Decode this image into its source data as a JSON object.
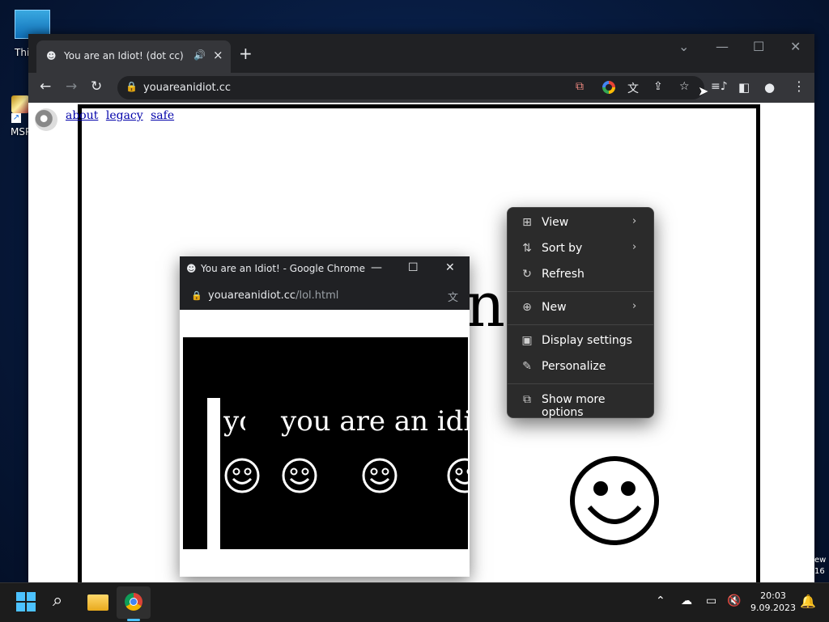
{
  "desktop": {
    "this_pc_label": "Thi",
    "msp_label": "MSP",
    "edge_text": [
      "ew",
      "16"
    ]
  },
  "browser": {
    "tab": {
      "title": "You are an Idiot! (dot cc)"
    },
    "address": {
      "url": "youareanidiot.cc"
    }
  },
  "page": {
    "links": [
      "about",
      "legacy",
      "safe"
    ],
    "big_text": "n    t"
  },
  "popup": {
    "title": "You are an Idiot! - Google Chrome",
    "url_host": "youareanidiot.cc",
    "url_path": "/lol.html",
    "text_main": "you are an idiot",
    "text_partial": "yo"
  },
  "context_menu": {
    "items": [
      {
        "label": "View",
        "icon": "grid-icon",
        "submenu": true
      },
      {
        "label": "Sort by",
        "icon": "sort-icon",
        "submenu": true
      },
      {
        "label": "Refresh",
        "icon": "refresh-icon",
        "submenu": false
      },
      {
        "label": "New",
        "icon": "plus-circle-icon",
        "submenu": true
      },
      {
        "label": "Display settings",
        "icon": "display-icon",
        "submenu": false
      },
      {
        "label": "Personalize",
        "icon": "brush-icon",
        "submenu": false
      },
      {
        "label": "Show more options",
        "icon": "more-options-icon",
        "submenu": false
      }
    ]
  },
  "taskbar": {
    "time": "20:03",
    "date": "9.09.2023"
  },
  "colors": {
    "accent": "#4cc2ff",
    "chrome_dark": "#202124",
    "menu_bg": "#2b2b2b"
  }
}
